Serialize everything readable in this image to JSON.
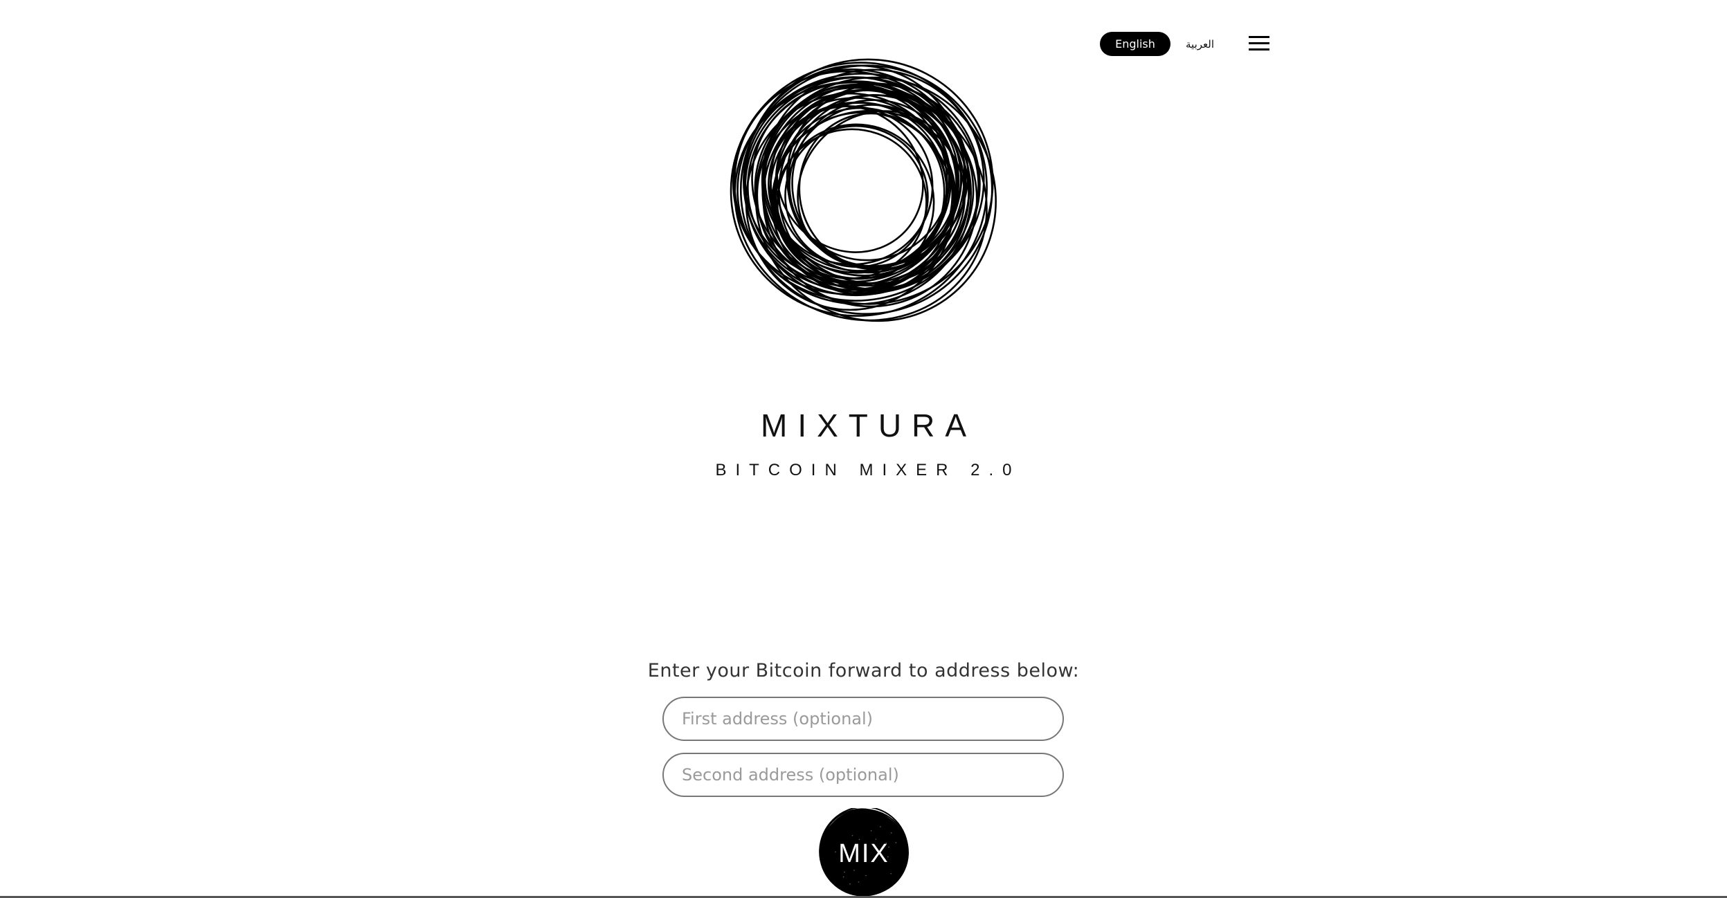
{
  "header": {
    "languages": [
      {
        "label": "English",
        "active": true
      },
      {
        "label": "العربية",
        "active": false
      }
    ],
    "menu_icon": "hamburger-menu-icon"
  },
  "logo": {
    "icon": "scribble-circle-logo"
  },
  "brand": {
    "title": "MIXTURA",
    "subtitle": "BITCOIN MIXER 2.0"
  },
  "form": {
    "prompt": "Enter your Bitcoin forward to address below:",
    "first_address": {
      "value": "",
      "placeholder": "First address (optional)"
    },
    "second_address": {
      "value": "",
      "placeholder": "Second address (optional)"
    },
    "submit_label": "MIX"
  },
  "colors": {
    "background": "#ffffff",
    "primary": "#000000",
    "input_border": "#777777",
    "placeholder": "#9a9a9a"
  }
}
